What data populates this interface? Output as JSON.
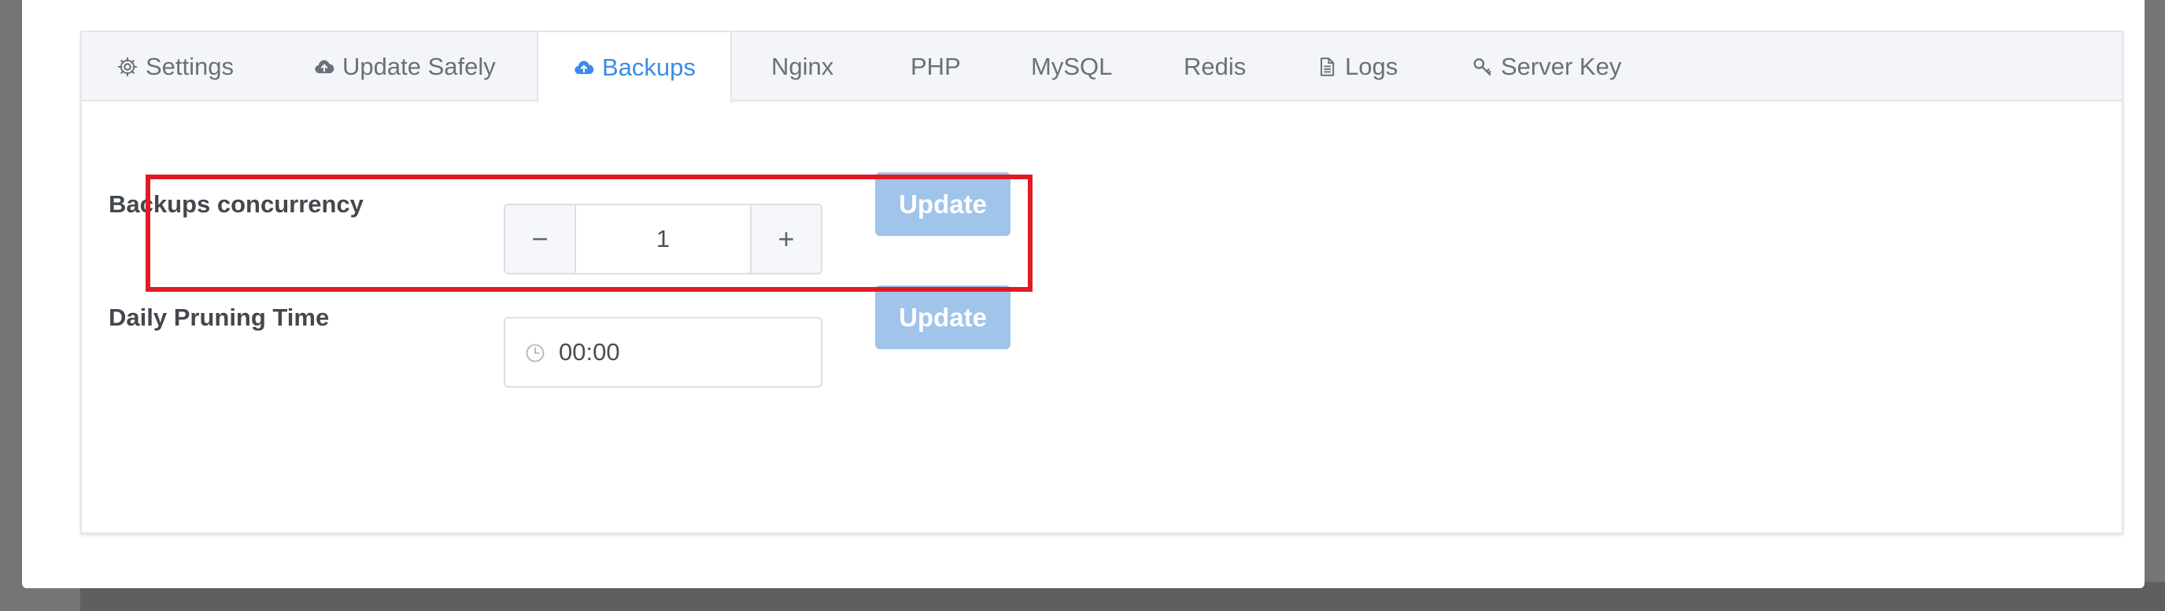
{
  "tabs": [
    {
      "label": "Settings",
      "icon": "gear-icon"
    },
    {
      "label": "Update Safely",
      "icon": "cloud-upload-icon"
    },
    {
      "label": "Backups",
      "icon": "cloud-upload-icon",
      "active": true
    },
    {
      "label": "Nginx"
    },
    {
      "label": "PHP"
    },
    {
      "label": "MySQL"
    },
    {
      "label": "Redis"
    },
    {
      "label": "Logs",
      "icon": "document-icon"
    },
    {
      "label": "Server Key",
      "icon": "key-icon"
    }
  ],
  "form": {
    "concurrency": {
      "label": "Backups concurrency",
      "value": "1",
      "decrement_symbol": "−",
      "increment_symbol": "+",
      "button": "Update"
    },
    "pruning": {
      "label": "Daily Pruning Time",
      "value": "00:00",
      "icon": "clock-icon",
      "button": "Update"
    }
  },
  "colors": {
    "accent": "#3b8ce8",
    "button_disabled": "#a0c4ea",
    "highlight": "#e01b24"
  }
}
